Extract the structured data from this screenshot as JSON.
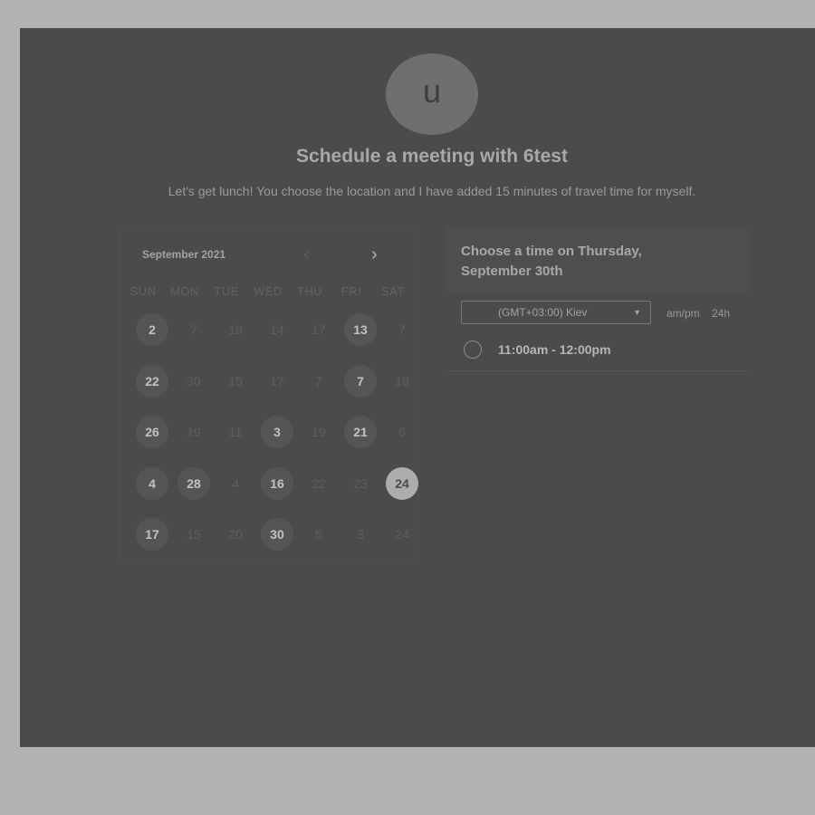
{
  "header": {
    "avatar_initial": "u",
    "title": "Schedule a meeting with 6test",
    "subtitle": "Let's get lunch! You choose the location and I have added 15 minutes of travel time for myself."
  },
  "calendar": {
    "month_label": "September 2021",
    "prev_icon": "chevron-left-icon",
    "next_icon": "chevron-right-icon",
    "weekdays": [
      "SUN",
      "MON",
      "TUE",
      "WED",
      "THU",
      "FRI",
      "SAT"
    ],
    "rows": [
      [
        {
          "label": "2",
          "status": "available"
        },
        {
          "label": "7",
          "status": "unavailable"
        },
        {
          "label": "19",
          "status": "unavailable"
        },
        {
          "label": "14",
          "status": "unavailable"
        },
        {
          "label": "17",
          "status": "unavailable"
        },
        {
          "label": "13",
          "status": "available"
        },
        {
          "label": "7",
          "status": "unavailable"
        }
      ],
      [
        {
          "label": "22",
          "status": "available"
        },
        {
          "label": "30",
          "status": "unavailable"
        },
        {
          "label": "15",
          "status": "unavailable"
        },
        {
          "label": "17",
          "status": "unavailable"
        },
        {
          "label": "7",
          "status": "unavailable"
        },
        {
          "label": "7",
          "status": "available"
        },
        {
          "label": "18",
          "status": "unavailable"
        }
      ],
      [
        {
          "label": "26",
          "status": "available"
        },
        {
          "label": "19",
          "status": "unavailable"
        },
        {
          "label": "11",
          "status": "unavailable"
        },
        {
          "label": "3",
          "status": "available"
        },
        {
          "label": "19",
          "status": "unavailable"
        },
        {
          "label": "21",
          "status": "available"
        },
        {
          "label": "6",
          "status": "unavailable"
        }
      ],
      [
        {
          "label": "4",
          "status": "available"
        },
        {
          "label": "28",
          "status": "available"
        },
        {
          "label": "4",
          "status": "unavailable"
        },
        {
          "label": "16",
          "status": "available"
        },
        {
          "label": "22",
          "status": "unavailable"
        },
        {
          "label": "23",
          "status": "unavailable"
        },
        {
          "label": "24",
          "status": "selected"
        }
      ],
      [
        {
          "label": "17",
          "status": "available"
        },
        {
          "label": "15",
          "status": "unavailable"
        },
        {
          "label": "20",
          "status": "unavailable"
        },
        {
          "label": "30",
          "status": "available"
        },
        {
          "label": "5",
          "status": "unavailable"
        },
        {
          "label": "3",
          "status": "unavailable"
        },
        {
          "label": "24",
          "status": "unavailable"
        }
      ]
    ]
  },
  "times": {
    "title": "Choose a time on Thursday, September 30th",
    "timezone": "(GMT+03:00) Kiev",
    "format_ampm": "am/pm",
    "format_24h": "24h",
    "slots": [
      "11:00am - 12:00pm"
    ]
  }
}
